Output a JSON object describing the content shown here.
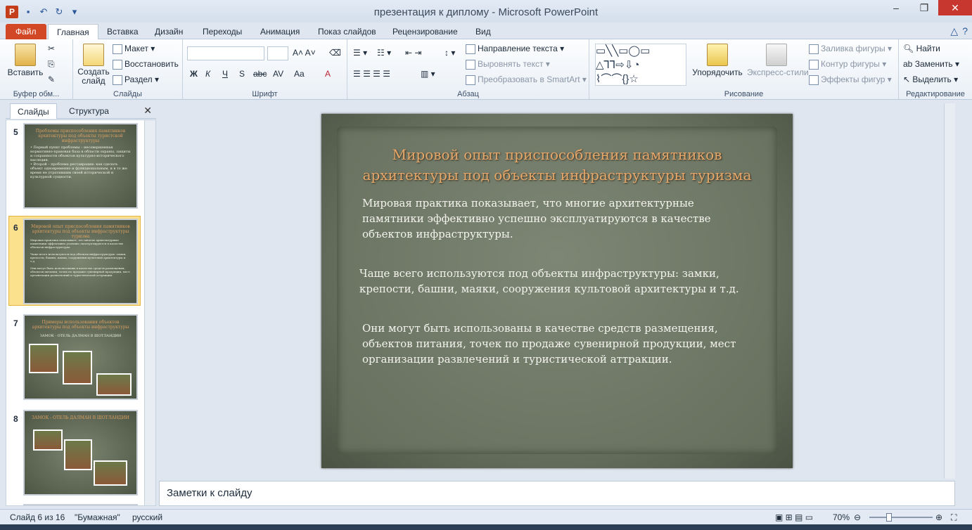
{
  "app": {
    "title": "презентация к диплому  -  Microsoft PowerPoint",
    "icon_letter": "P"
  },
  "window_controls": {
    "minimize": "–",
    "restore": "❐",
    "close": "✕"
  },
  "ribbon_tabs": [
    "Файл",
    "Главная",
    "Вставка",
    "Дизайн",
    "Переходы",
    "Анимация",
    "Показ слайдов",
    "Рецензирование",
    "Вид"
  ],
  "ribbon": {
    "clipboard": {
      "paste": "Вставить",
      "label": "Буфер обм..."
    },
    "slides": {
      "new_slide": "Создать слайд",
      "layout": "Макет",
      "reset": "Восстановить",
      "section": "Раздел",
      "label": "Слайды"
    },
    "font": {
      "label": "Шрифт",
      "bold": "Ж",
      "italic": "К",
      "underline": "Ч",
      "shadow": "S",
      "strike": "abc",
      "spacing": "AV",
      "case": "Aa",
      "color": "A"
    },
    "paragraph": {
      "label": "Абзац",
      "text_direction": "Направление текста",
      "align_text": "Выровнять текст",
      "smartart": "Преобразовать в SmartArt"
    },
    "drawing": {
      "label": "Рисование",
      "arrange": "Упорядочить",
      "quick_styles": "Экспресс-стили",
      "fill": "Заливка фигуры",
      "outline": "Контур фигуры",
      "effects": "Эффекты фигур"
    },
    "editing": {
      "label": "Редактирование",
      "find": "Найти",
      "replace": "Заменить",
      "select": "Выделить"
    }
  },
  "pane": {
    "tab_slides": "Слайды",
    "tab_outline": "Структура",
    "close": "✕"
  },
  "thumbnails": [
    {
      "num": "5",
      "title": "Проблемы приспособления памятников архитектуры под объекты туристской инфраструктуры",
      "body": "• Первый пункт проблемы – несовершенная нормативно-правовая база в области охраны, защиты и сохранности объектов культурно-исторического наследия.\n• Второй – проблема реставрации: как сделать объект одновременно и функциональным, и в то же время не утратившим своей исторической и культурной сущности."
    },
    {
      "num": "6",
      "title": "Мировой опыт приспособления памятников архитектуры под объекты инфраструктуры туризма",
      "body": "Мировая практика показывает, что многие архитектурные памятники эффективно успешно эксплуатируются в качестве объектов инфраструктуры.\n\nЧаще всего используются под объекты инфраструктуры: замки, крепости, башни, маяки, сооружения культовой архитектуры и т.д.\n\nОни могут быть использованы в качестве средств размещения, объектов питания, точек по продаже сувенирной продукции, мест организации развлечений и туристической аттракции."
    },
    {
      "num": "7",
      "title": "Примеры использования объектов архитектуры под объекты инфраструктуры",
      "body": "ЗАМОК - ОТЕЛЬ ДАЛМАН В ШОТЛАНДИИ"
    },
    {
      "num": "8",
      "title": "ЗАМОК - ОТЕЛЬ ДАЛМАН В ШОТЛАНДИИ",
      "body": ""
    }
  ],
  "slide": {
    "title": "Мировой опыт приспособления памятников архитектуры  под объекты инфраструктуры туризма",
    "paragraphs": [
      "Мировая практика показывает,  что  многие архитектурные\n памятники эффективно успешно эксплуатируются в качестве\n объектов инфраструктуры.",
      "Чаще всего   используются под объекты инфраструктуры: замки,\n крепости, башни, маяки, сооружения культовой архитектуры и т.д.",
      "Они  могут быть использованы в качестве средств размещения,\n объектов питания, точек по продаже сувенирной продукции,  мест\n организации развлечений и туристической аттракции."
    ]
  },
  "notes": {
    "placeholder": "Заметки к слайду"
  },
  "status": {
    "slide_info": "Слайд 6 из 16",
    "theme": "\"Бумажная\"",
    "language": "русский",
    "zoom": "70%"
  }
}
